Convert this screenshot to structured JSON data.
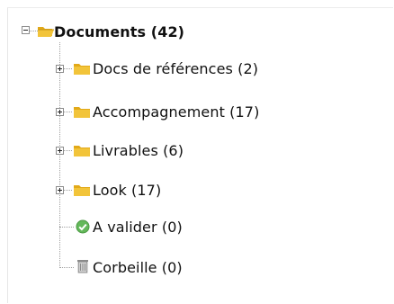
{
  "tree": {
    "root": {
      "label": "Documents (42)",
      "icon": "folder-open-icon"
    },
    "items": [
      {
        "label": "Docs de références (2)",
        "icon": "folder-icon",
        "expandable": true
      },
      {
        "label": "Accompagnement (17)",
        "icon": "folder-icon",
        "expandable": true
      },
      {
        "label": "Livrables (6)",
        "icon": "folder-icon",
        "expandable": true
      },
      {
        "label": "Look (17)",
        "icon": "folder-icon",
        "expandable": true
      },
      {
        "label": "A valider (0)",
        "icon": "check-circle-icon",
        "expandable": false
      },
      {
        "label": "Corbeille (0)",
        "icon": "trash-icon",
        "expandable": false
      }
    ]
  },
  "colors": {
    "folder": "#f2c43a",
    "folder_shade": "#e2a919",
    "check": "#63b85a",
    "trash": "#8b8b8b"
  }
}
